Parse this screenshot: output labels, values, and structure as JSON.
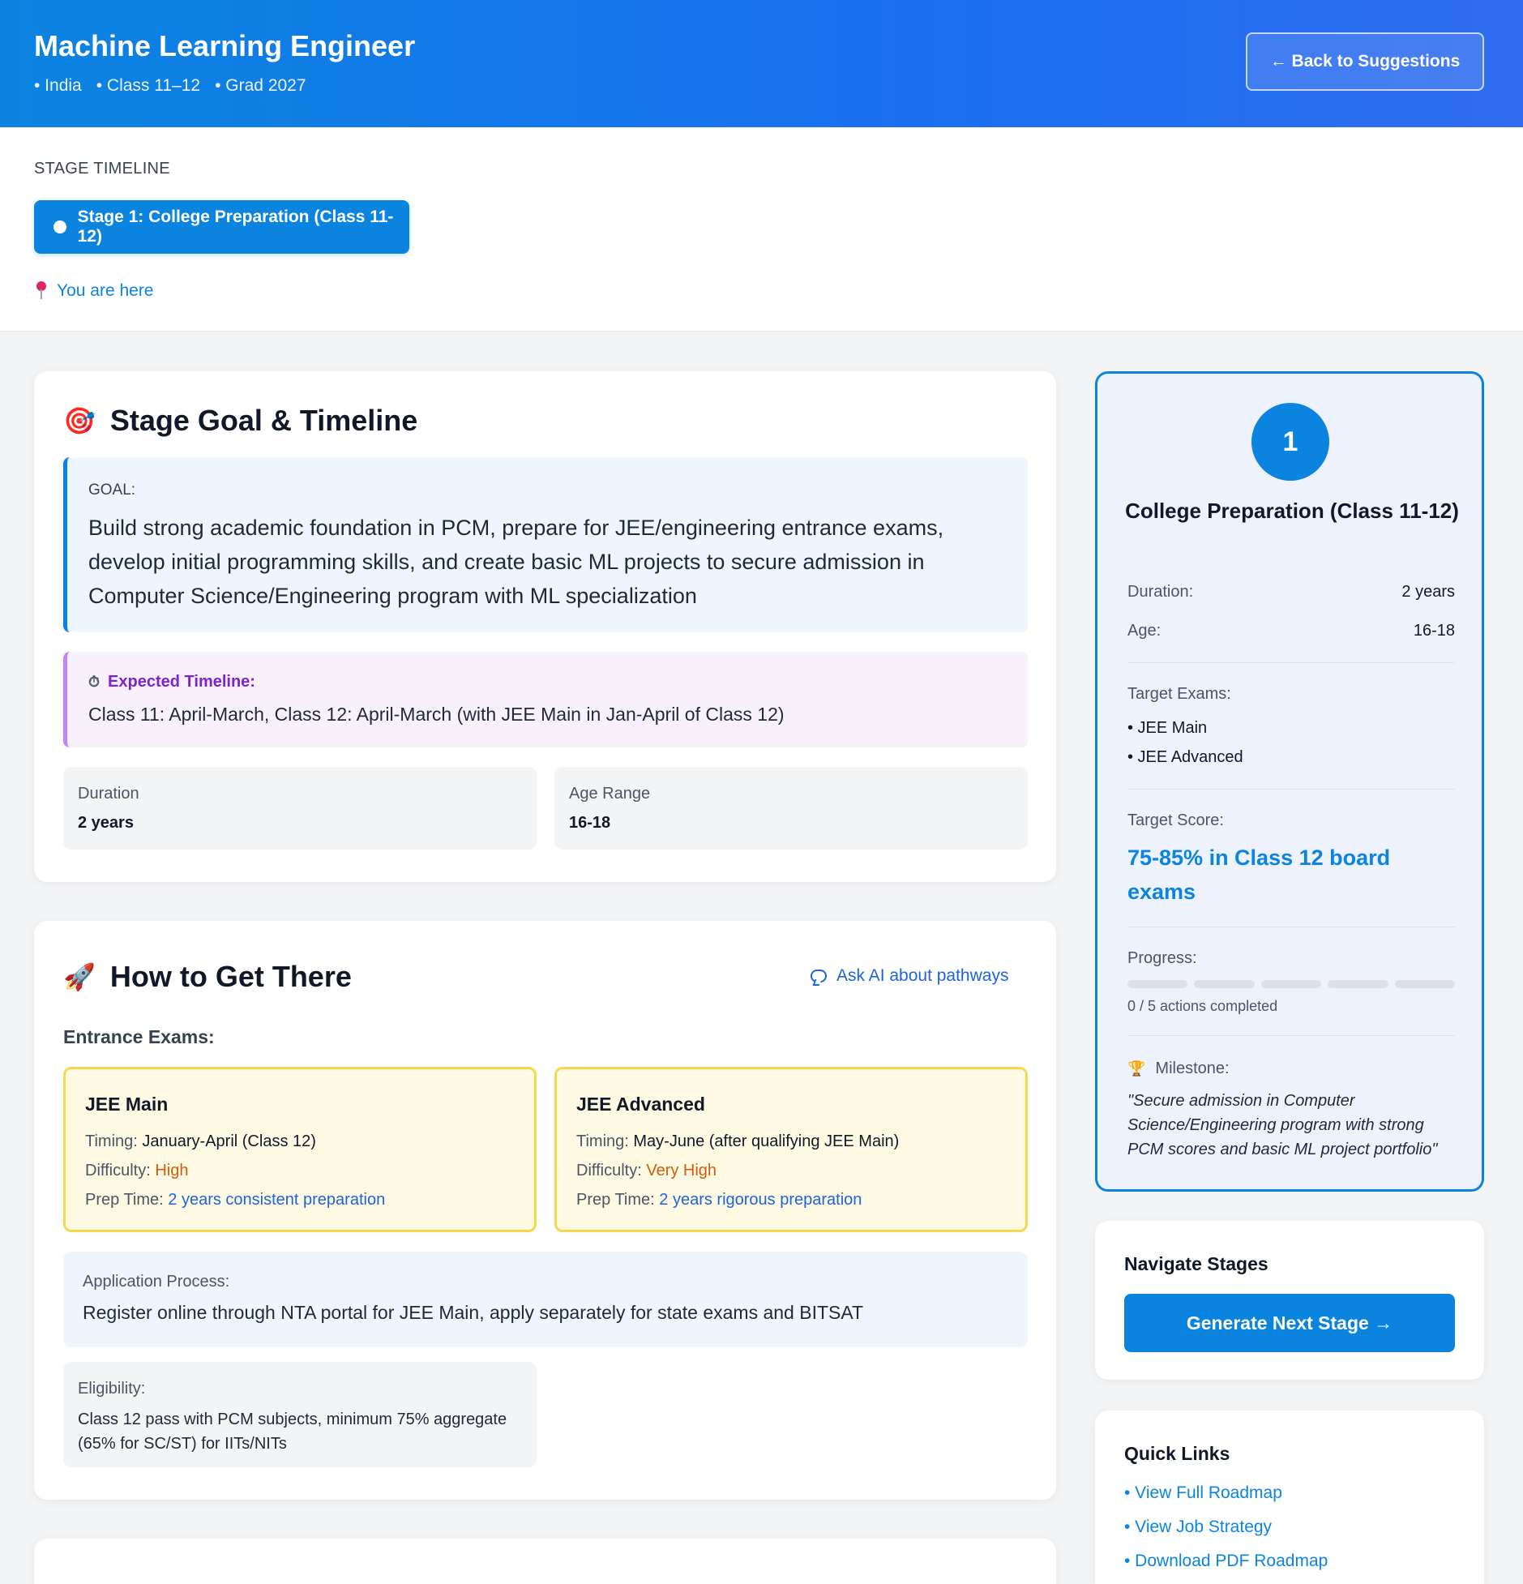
{
  "header": {
    "title": "Machine Learning Engineer",
    "meta": [
      "• India",
      "• Class 11–12",
      "• Grad 2027"
    ],
    "back_label": "← Back to Suggestions"
  },
  "timeline": {
    "label": "STAGE TIMELINE",
    "stage_pill": "Stage 1: College Preparation (Class 11-12)",
    "you_are_here": "You are here"
  },
  "goal_card": {
    "icon": "target-icon",
    "emoji": "🎯",
    "title": "Stage Goal & Timeline",
    "goal_label": "GOAL:",
    "goal_text": "Build strong academic foundation in PCM, prepare for JEE/engineering entrance exams, develop initial programming skills, and create basic ML projects to secure admission in Computer Science/Engineering program with ML specialization",
    "timeline_icon": "stopwatch-icon",
    "timeline_emoji": "⏱",
    "timeline_label": "Expected Timeline:",
    "timeline_text": "Class 11: April-March, Class 12: April-March (with JEE Main in Jan-April of Class 12)",
    "duration_label": "Duration",
    "duration_value": "2 years",
    "age_label": "Age Range",
    "age_value": "16-18"
  },
  "how_card": {
    "icon": "rocket-icon",
    "emoji": "🚀",
    "title": "How to Get There",
    "ask_ai": "Ask AI about pathways",
    "entrance_label": "Entrance Exams:",
    "exams": [
      {
        "name": "JEE Main",
        "timing_label": "Timing:",
        "timing": "January-April (Class 12)",
        "difficulty_label": "Difficulty:",
        "difficulty": "High",
        "prep_label": "Prep Time:",
        "prep": "2 years consistent preparation"
      },
      {
        "name": "JEE Advanced",
        "timing_label": "Timing:",
        "timing": "May-June (after qualifying JEE Main)",
        "difficulty_label": "Difficulty:",
        "difficulty": "Very High",
        "prep_label": "Prep Time:",
        "prep": "2 years rigorous preparation"
      }
    ],
    "application_label": "Application Process:",
    "application_text": "Register online through NTA portal for JEE Main, apply separately for state exams and BITSAT",
    "eligibility_label": "Eligibility:",
    "eligibility_text": "Class 12 pass with PCM subjects, minimum 75% aggregate (65% for SC/ST) for IITs/NITs"
  },
  "stage_card": {
    "number": "1",
    "name": "College Preparation (Class 11-12)",
    "duration_label": "Duration:",
    "duration_value": "2 years",
    "age_label": "Age:",
    "age_value": "16-18",
    "exams_label": "Target Exams:",
    "exams": [
      "• JEE Main",
      "• JEE Advanced"
    ],
    "score_label": "Target Score:",
    "score_value": "75-85% in Class 12 board exams",
    "progress_label": "Progress:",
    "progress_completed": 0,
    "progress_total": 5,
    "progress_text": "0 / 5 actions completed",
    "milestone_icon": "trophy-icon",
    "milestone_emoji": "🏆",
    "milestone_label": "Milestone:",
    "milestone_text": "\"Secure admission in Computer Science/Engineering program with strong PCM scores and basic ML project portfolio\""
  },
  "navigate": {
    "title": "Navigate Stages",
    "button": "Generate Next Stage →"
  },
  "quick_links": {
    "title": "Quick Links",
    "links": [
      "• View Full Roadmap",
      "• View Job Strategy",
      "• Download PDF Roadmap"
    ]
  },
  "colors": {
    "primary": "#0b84e0",
    "header_gradient_end": "#2f6cf0",
    "exam_border": "#f5d94b",
    "difficulty": "#d45b0a",
    "timeline_accent": "#7e22ce"
  }
}
